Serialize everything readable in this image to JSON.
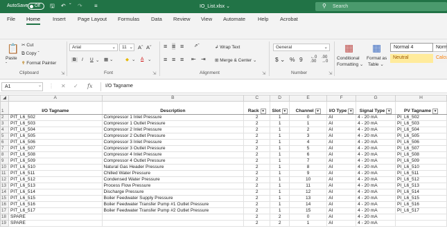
{
  "titlebar": {
    "autosave_label": "AutoSave",
    "autosave_state": "Off",
    "save_icon": "save-icon",
    "undo_icon": "undo-icon",
    "redo_icon": "redo-icon",
    "filename": "IO_List.xlsx",
    "search_placeholder": "Search"
  },
  "tabs": [
    "File",
    "Home",
    "Insert",
    "Page Layout",
    "Formulas",
    "Data",
    "Review",
    "View",
    "Automate",
    "Help",
    "Acrobat"
  ],
  "active_tab": "Home",
  "ribbon": {
    "clipboard": {
      "paste": "Paste",
      "cut": "Cut",
      "copy": "Copy",
      "format_painter": "Format Painter",
      "label": "Clipboard"
    },
    "font": {
      "name": "Arial",
      "size": "11",
      "label": "Font",
      "bold": "B",
      "italic": "I",
      "underline": "U"
    },
    "alignment": {
      "wrap_text": "Wrap Text",
      "merge_center": "Merge & Center",
      "label": "Alignment"
    },
    "number": {
      "format": "General",
      "currency": "$",
      "percent": "%",
      "comma": "9",
      "label": "Number"
    },
    "styles": {
      "conditional": "Conditional",
      "conditional2": "Formatting",
      "format_as": "Format as",
      "format_as2": "Table",
      "normal4": "Normal 4",
      "normal": "Norm",
      "neutral": "Neutral",
      "calc": "Calcu"
    }
  },
  "formula_bar": {
    "cell_ref": "A1",
    "content": "I/O Tagname"
  },
  "sheet": {
    "columns": [
      "A",
      "B",
      "C",
      "D",
      "E",
      "F",
      "G",
      "H"
    ],
    "headers": [
      "I/O Tagname",
      "Description",
      "Rack",
      "Slot",
      "Channel",
      "I/O Type",
      "Signal Type",
      "PV Tagname"
    ],
    "rows": [
      [
        "PIT_L6_502",
        "Compressor 1 Inlet Pressure",
        "2",
        "1",
        "0",
        "AI",
        "4 - 20 mA",
        "PI_L6_502"
      ],
      [
        "PIT_L6_503",
        "Compressor 1 Outlet Pressure",
        "2",
        "1",
        "1",
        "AI",
        "4 - 20 mA",
        "PI_L6_503"
      ],
      [
        "PIT_L6_504",
        "Compressor 2 Inlet Pressure",
        "2",
        "1",
        "2",
        "AI",
        "4 - 20 mA",
        "PI_L6_504"
      ],
      [
        "PIT_L6_505",
        "Compressor 2 Outlet Pressure",
        "2",
        "1",
        "3",
        "AI",
        "4 - 20 mA",
        "PI_L6_505"
      ],
      [
        "PIT_L6_506",
        "Compressor 3 Inlet Pressure",
        "2",
        "1",
        "4",
        "AI",
        "4 - 20 mA",
        "PI_L6_506"
      ],
      [
        "PIT_L6_507",
        "Compressor 3 Outlet Pressure",
        "2",
        "1",
        "5",
        "AI",
        "4 - 20 mA",
        "PI_L6_507"
      ],
      [
        "PIT_L6_508",
        "Compressor 4 Inlet Pressure",
        "2",
        "1",
        "6",
        "AI",
        "4 - 20 mA",
        "PI_L6_508"
      ],
      [
        "PIT_L6_509",
        "Compressor 4 Outlet Pressure",
        "2",
        "1",
        "7",
        "AI",
        "4 - 20 mA",
        "PI_L6_509"
      ],
      [
        "PIT_L6_510",
        "Natural Gas Header Pressure",
        "2",
        "1",
        "8",
        "AI",
        "4 - 20 mA",
        "PI_L6_510"
      ],
      [
        "PIT_L6_511",
        "Chilled Water Pressure",
        "2",
        "1",
        "9",
        "AI",
        "4 - 20 mA",
        "PI_L6_511"
      ],
      [
        "PIT_L6_512",
        "Condensed Water Pressure",
        "2",
        "1",
        "10",
        "AI",
        "4 - 20 mA",
        "PI_L6_512"
      ],
      [
        "PIT_L6_513",
        "Process Flow Pressure",
        "2",
        "1",
        "11",
        "AI",
        "4 - 20 mA",
        "PI_L6_513"
      ],
      [
        "PIT_L6_514",
        "Discharge Pressure",
        "2",
        "1",
        "12",
        "AI",
        "4 - 20 mA",
        "PI_L6_514"
      ],
      [
        "PIT_L6_515",
        "Boiler Feedwater Supply Pressure",
        "2",
        "1",
        "13",
        "AI",
        "4 - 20 mA",
        "PI_L6_515"
      ],
      [
        "PIT_L6_516",
        "Boiler Feedwater Transfer Pump #1 Outlet Pressure",
        "2",
        "1",
        "14",
        "AI",
        "4 - 20 mA",
        "PI_L6_516"
      ],
      [
        "PIT_L6_517",
        "Boiler Feedwater Transfer Pump #2 Outlet Pressure",
        "2",
        "1",
        "15",
        "AI",
        "4 - 20 mA",
        "PI_L6_517"
      ],
      [
        "SPARE",
        "",
        "2",
        "2",
        "0",
        "AI",
        "4 - 20 mA",
        ""
      ],
      [
        "SPARE",
        "",
        "2",
        "2",
        "1",
        "AI",
        "4 - 20 mA",
        ""
      ]
    ]
  }
}
